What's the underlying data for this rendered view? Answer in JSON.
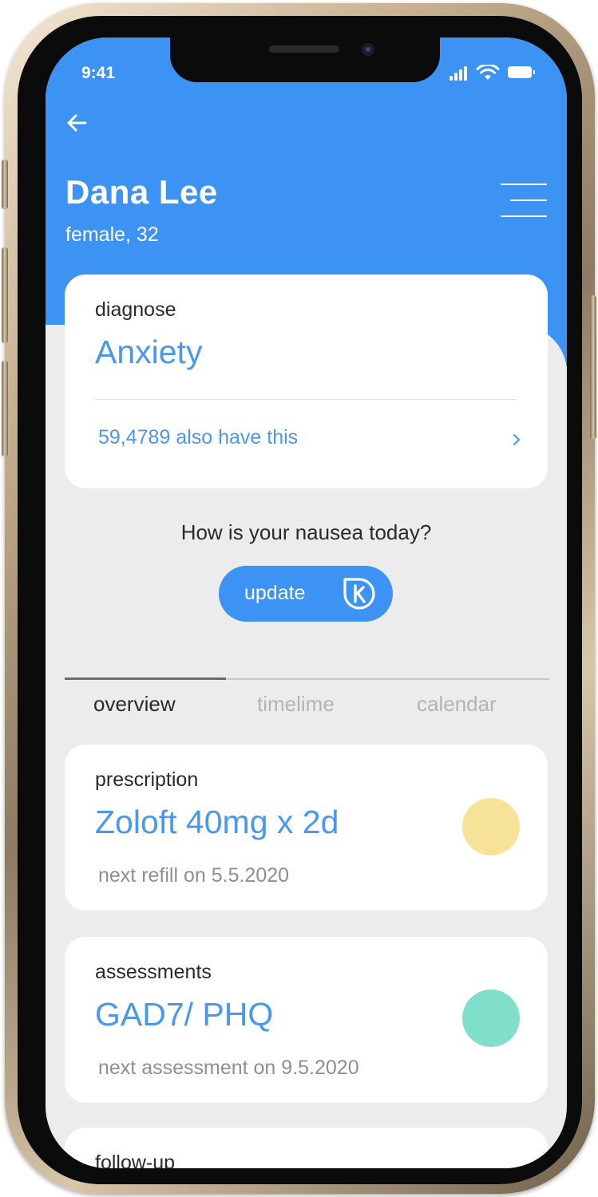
{
  "status_bar": {
    "time": "9:41"
  },
  "header": {
    "back_icon": "arrow-left-icon",
    "name": "Dana Lee",
    "info": "female, 32",
    "menu_icon": "menu-icon"
  },
  "diagnosis_card": {
    "label": "diagnose",
    "value": "Anxiety",
    "link_text": "59,4789 also have this",
    "link_icon": "chevron-right-icon"
  },
  "checkin": {
    "question": "How is your nausea today?",
    "button_label": "update",
    "button_icon": "k-logo-icon"
  },
  "tabs": [
    {
      "label": "overview",
      "active": true
    },
    {
      "label": "timelime",
      "active": false
    },
    {
      "label": "calendar",
      "active": false
    }
  ],
  "items": [
    {
      "label": "prescription",
      "value": "Zoloft 40mg x 2d",
      "sub": "next refill on 5.5.2020",
      "dot_color": "#f7e398"
    },
    {
      "label": "assessments",
      "value": "GAD7/ PHQ",
      "sub": "next assessment on 9.5.2020",
      "dot_color": "#7fdfcb"
    },
    {
      "label": "follow-up"
    }
  ],
  "colors": {
    "primary": "#3d93f4",
    "accent_text": "#4a98ee",
    "background": "#ececec"
  }
}
